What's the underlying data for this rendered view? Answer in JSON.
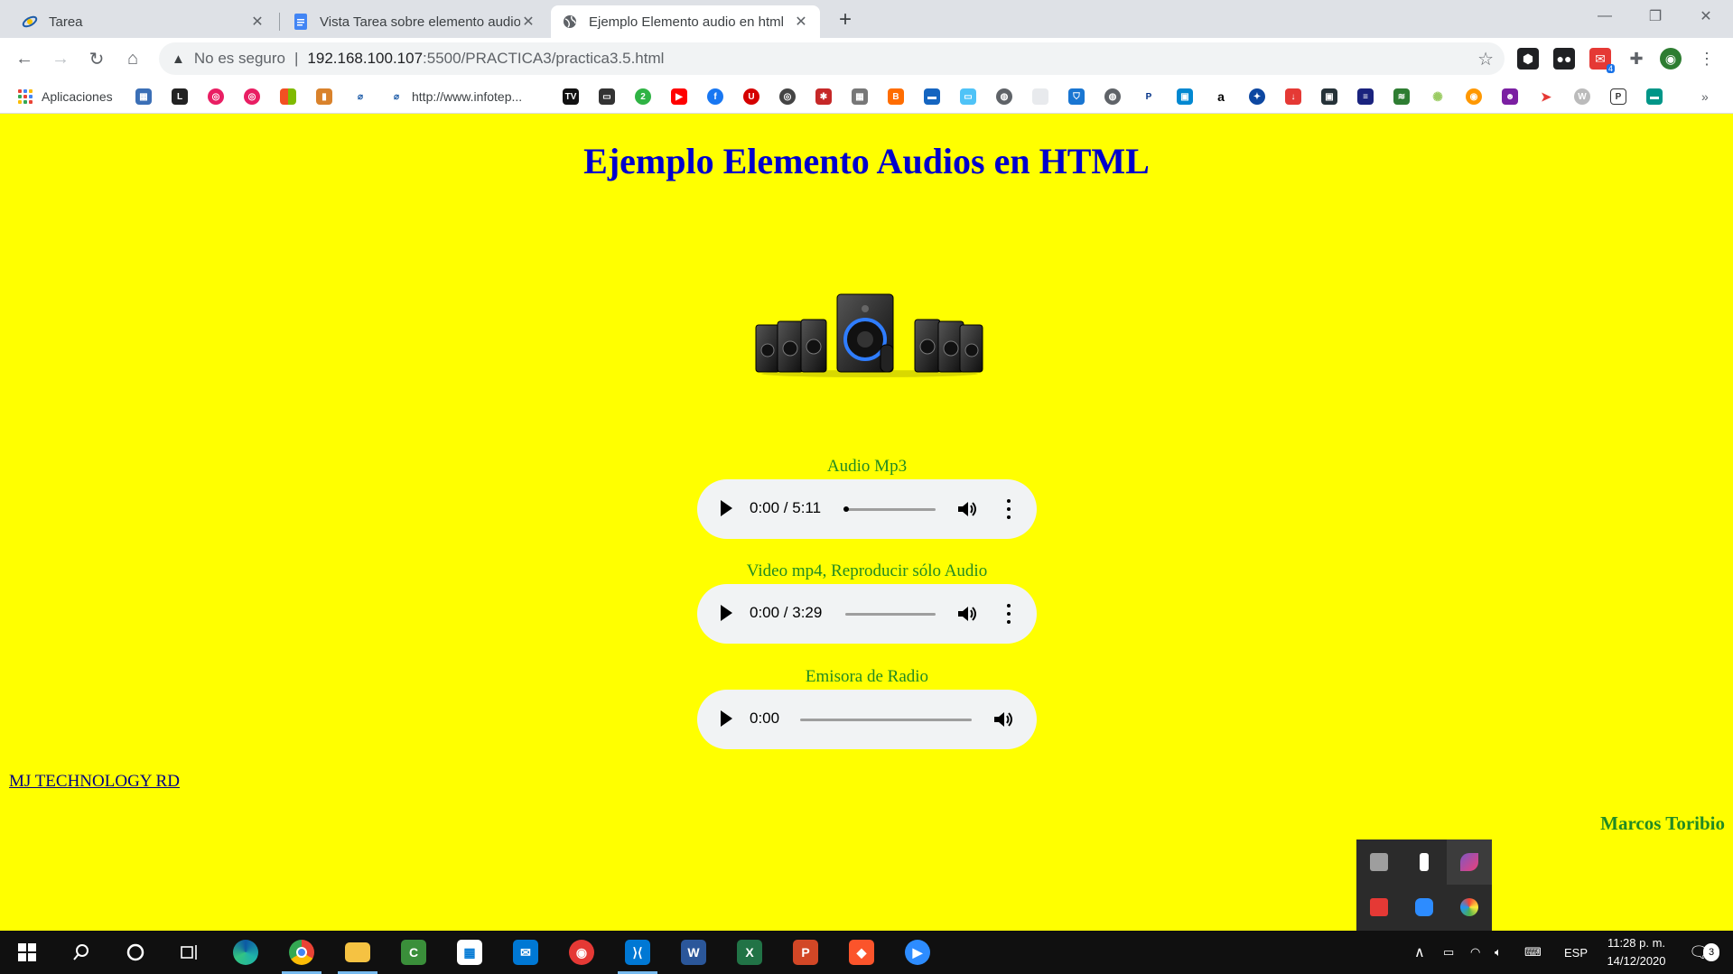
{
  "browser": {
    "tabs": [
      {
        "title": "Tarea",
        "active": false
      },
      {
        "title": "Vista Tarea sobre elemento audio",
        "active": false
      },
      {
        "title": "Ejemplo Elemento audio en html",
        "active": true
      }
    ],
    "address": {
      "security_label": "No es seguro",
      "host": "192.168.100.107",
      "path": ":5500/PRACTICA3/practica3.5.html"
    },
    "extension_badge": "4",
    "bookmarks": {
      "apps_label": "Aplicaciones",
      "infotep_label": "http://www.infotep..."
    }
  },
  "page": {
    "title": "Ejemplo Elemento Audios en HTML",
    "image_alt": "speaker system",
    "players": [
      {
        "label": "Audio Mp3",
        "time": "0:00 / 5:11",
        "progress": 0.0
      },
      {
        "label": "Video mp4, Reproducir sólo Audio",
        "time": "0:00 / 3:29",
        "progress": 0.0
      },
      {
        "label": "Emisora de Radio",
        "time": "0:00",
        "progress": 0.0
      }
    ],
    "footer_link": "MJ TECHNOLOGY RD",
    "author": "Marcos Toribio",
    "background_color": "#ffff00",
    "title_color": "#0000cc",
    "label_color": "#228b22"
  },
  "taskbar": {
    "language": "ESP",
    "time": "11:28 p. m.",
    "date": "14/12/2020",
    "notifications": "3"
  }
}
